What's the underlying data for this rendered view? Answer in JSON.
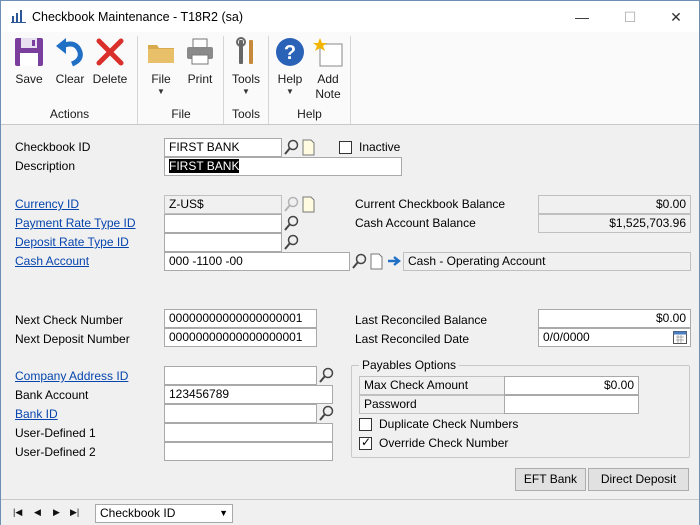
{
  "window": {
    "title": "Checkbook Maintenance  -  T18R2 (sa)",
    "minimize": "—",
    "maximize": "☐",
    "close": "✕"
  },
  "ribbon": {
    "save": "Save",
    "clear": "Clear",
    "delete": "Delete",
    "file": "File",
    "print": "Print",
    "tools": "Tools",
    "help": "Help",
    "add_note_1": "Add",
    "add_note_2": "Note",
    "group_actions": "Actions",
    "group_file": "File",
    "group_tools": "Tools",
    "group_help": "Help"
  },
  "form": {
    "checkbook_id_label": "Checkbook ID",
    "checkbook_id": "FIRST BANK",
    "inactive_label": "Inactive",
    "description_label": "Description",
    "description": "FIRST BANK",
    "currency_id_label": "Currency ID",
    "currency_id": "Z-US$",
    "payment_rate_label": "Payment Rate Type ID",
    "payment_rate": "",
    "deposit_rate_label": "Deposit Rate Type ID",
    "deposit_rate": "",
    "cash_account_label": "Cash Account",
    "cash_account": "000 -1100 -00",
    "cash_account_desc": "Cash - Operating Account",
    "current_balance_label": "Current Checkbook Balance",
    "current_balance": "$0.00",
    "cash_account_balance_label": "Cash Account Balance",
    "cash_account_balance": "$1,525,703.96",
    "next_check_label": "Next Check Number",
    "next_check": "00000000000000000001",
    "next_deposit_label": "Next Deposit Number",
    "next_deposit": "00000000000000000001",
    "last_rec_balance_label": "Last Reconciled Balance",
    "last_rec_balance": "$0.00",
    "last_rec_date_label": "Last Reconciled Date",
    "last_rec_date": "0/0/0000",
    "company_address_label": "Company Address ID",
    "company_address": "",
    "bank_account_label": "Bank Account",
    "bank_account": "123456789",
    "bank_id_label": "Bank ID",
    "bank_id": "",
    "user_defined_1_label": "User-Defined 1",
    "user_defined_1": "",
    "user_defined_2_label": "User-Defined 2",
    "user_defined_2": ""
  },
  "payables": {
    "title": "Payables Options",
    "max_check_label": "Max Check Amount",
    "max_check": "$0.00",
    "password_label": "Password",
    "password": "",
    "duplicate_label": "Duplicate Check Numbers",
    "duplicate_checked": false,
    "override_label": "Override Check Number",
    "override_checked": true
  },
  "buttons": {
    "eft_bank": "EFT Bank",
    "direct_deposit": "Direct Deposit"
  },
  "status": {
    "sort_by": "Checkbook ID"
  }
}
